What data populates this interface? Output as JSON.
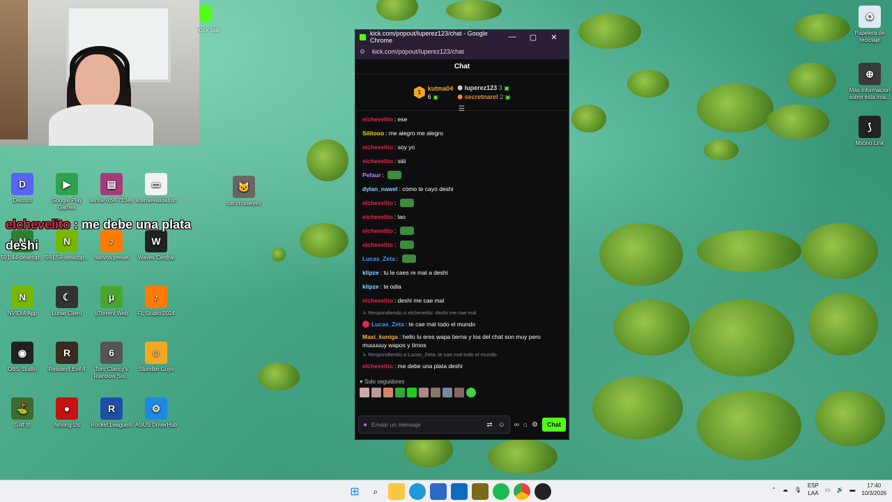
{
  "chrome_window": {
    "title": "kick.com/popout/luperez123/chat - Google Chrome",
    "url": "kick.com/popout/luperez123/chat",
    "minimize": "—",
    "maximize": "▢",
    "close": "✕"
  },
  "chat": {
    "header": "Chat",
    "leaderboard": {
      "first": {
        "rank": "1",
        "name": "kutma04",
        "count": "6"
      },
      "second": {
        "name": "luperez123",
        "count": "3"
      },
      "third": {
        "name": "secretnarel",
        "count": "2"
      }
    },
    "messages": [
      {
        "user": "elchevelito",
        "text": "ese",
        "color": "#e0284a"
      },
      {
        "user": "Silitooo",
        "text": "me alegro me alegro",
        "color": "#f5d60c"
      },
      {
        "user": "elchevelito",
        "text": "soy yo",
        "color": "#e0284a"
      },
      {
        "user": "elchevelito",
        "text": "siiii",
        "color": "#e0284a"
      },
      {
        "user": "Pefaur",
        "text": "",
        "color": "#b98bff"
      },
      {
        "user": "dylan_nawel",
        "text": "como te cayo deshi",
        "color": "#8bd2ff"
      },
      {
        "user": "elchevelito",
        "text": "",
        "color": "#e0284a"
      },
      {
        "user": "elchevelito",
        "text": "lao",
        "color": "#e0284a"
      },
      {
        "user": "elchevelito",
        "text": "",
        "color": "#e0284a"
      },
      {
        "user": "elchevelito",
        "text": "",
        "color": "#e0284a"
      },
      {
        "user": "Lucas_Zeta",
        "text": "",
        "color": "#3f9bff"
      },
      {
        "user": "klipze",
        "text": "tu le caes re mal a deshi",
        "color": "#8bd2ff"
      },
      {
        "user": "klipze",
        "text": "te odia",
        "color": "#8bd2ff"
      },
      {
        "user": "elchevelito",
        "text": "deshi me cae mal",
        "color": "#e0284a"
      }
    ],
    "reply1": "Respondiendo a elchevelito: deshi me cae mal",
    "reply1_msg": {
      "user": "Lucas_Zeta",
      "text": "te cae mal todo el mundo",
      "color": "#3f9bff"
    },
    "long_msg": {
      "user": "Maxi_kuniga",
      "text": "hello lu eres wapa tierna y los del chat son muy pero muuuuuy wapos y tirnos",
      "color": "#ffb347"
    },
    "reply2": "Respondiendo a Lucas_Zeta: te cae mal todo el mundo",
    "reply2_msg": {
      "user": "elchevelito",
      "text": "me debe una plata deshi",
      "color": "#e0284a"
    },
    "solo": "Solo seguidores",
    "input_placeholder": "Enviar un mensaje",
    "send": "Chat"
  },
  "overlay": {
    "user": "elchevelito",
    "text": " : me debe una plata deshi"
  },
  "kick_label": "kick talk",
  "desktop_icons": [
    {
      "label": "Discord",
      "color": "#5865f2",
      "glyph": "D"
    },
    {
      "label": "Google Play Games",
      "color": "#2fa24d",
      "glyph": "▶"
    },
    {
      "label": "winrar-x64-713es",
      "color": "#a83a7a",
      "glyph": "▤"
    },
    {
      "label": "licensevalidation",
      "color": "#f2f2f2",
      "glyph": "▭"
    },
    {
      "label": "cat-crosseyes",
      "color": "#666",
      "glyph": "🐱"
    },
    {
      "label": "591.44-desktop...",
      "color": "#2e7d32",
      "glyph": "N"
    },
    {
      "label": "591.59-desktop...",
      "color": "#76b900",
      "glyph": "N"
    },
    {
      "label": "nativos preset",
      "color": "#ff7a00",
      "glyph": "♪"
    },
    {
      "label": "Waves Central",
      "color": "#222",
      "glyph": "W"
    },
    {
      "label": "NVIDIA App",
      "color": "#76b900",
      "glyph": "N"
    },
    {
      "label": "Lunar Client",
      "color": "#333",
      "glyph": "☾"
    },
    {
      "label": "uTorrent Web",
      "color": "#4aa52e",
      "glyph": "μ"
    },
    {
      "label": "FL Studio 2024",
      "color": "#ff7a00",
      "glyph": "♪"
    },
    {
      "label": "OBS Studio",
      "color": "#222",
      "glyph": "◉"
    },
    {
      "label": "Resident Evil 4",
      "color": "#3b2a1f",
      "glyph": "R"
    },
    {
      "label": "Tom Clancy's Rainbow Six...",
      "color": "#555",
      "glyph": "6"
    },
    {
      "label": "Stumble Guys",
      "color": "#f2a922",
      "glyph": "☺"
    },
    {
      "label": "Golf It!",
      "color": "#3d6b30",
      "glyph": "⛳"
    },
    {
      "label": "Among Us",
      "color": "#c51111",
      "glyph": "●"
    },
    {
      "label": "Rocket League®",
      "color": "#1e4fa8",
      "glyph": "R"
    },
    {
      "label": "ASUS DriverHub",
      "color": "#1e88e5",
      "glyph": "⚙"
    },
    {
      "label": "Papelera de reciclaje",
      "color": "#dfe9f3",
      "glyph": "♻"
    },
    {
      "label": "Más información sobre esta ima...",
      "color": "#3a3a3a",
      "glyph": "⊕"
    },
    {
      "label": "Msono Link",
      "color": "#222",
      "glyph": "⟆"
    }
  ],
  "taskbar": {
    "lang_top": "ESP",
    "lang_bottom": "LAA",
    "time": "17:40",
    "date": "10/3/2026"
  }
}
